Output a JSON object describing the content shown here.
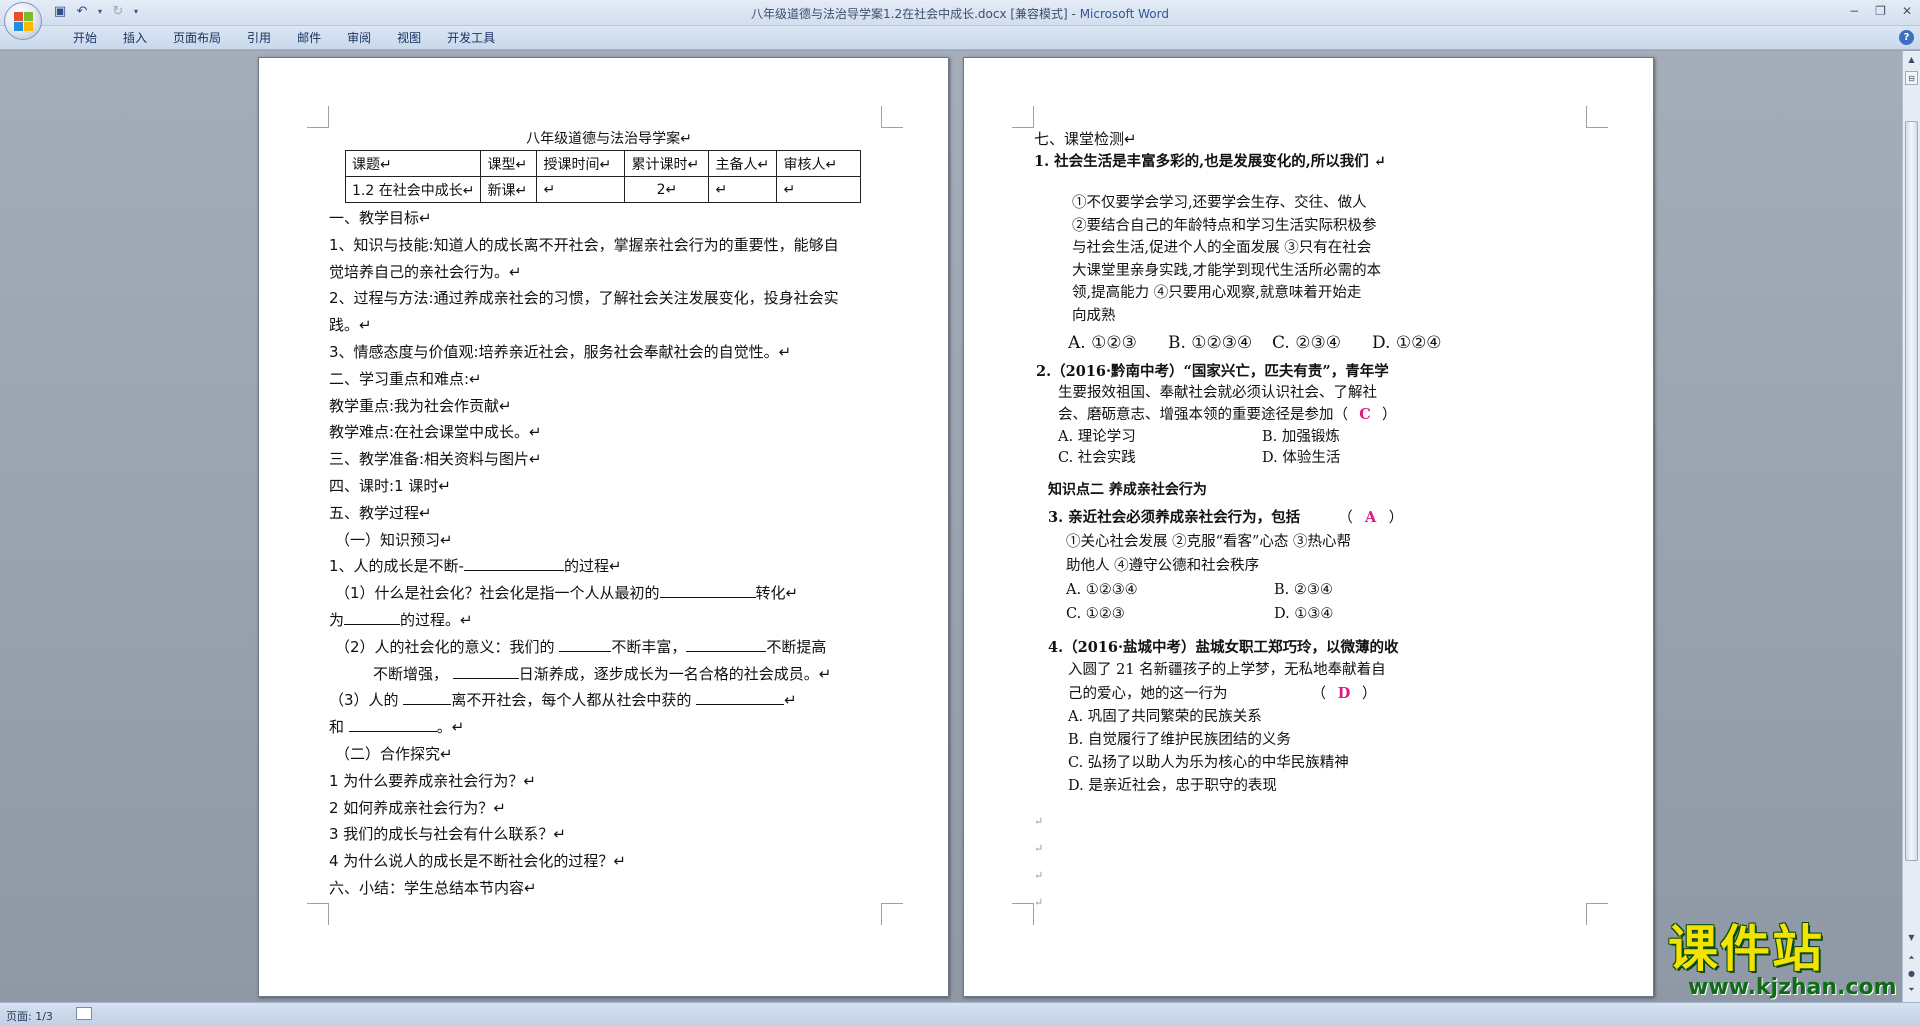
{
  "window": {
    "title_doc": "八年级道德与法治导学案1.2在社会中成长.docx [兼容模式] - ",
    "title_app": "Microsoft Word",
    "min": "−",
    "restore": "❐",
    "close": "✕"
  },
  "ribbon": {
    "tabs": [
      "开始",
      "插入",
      "页面布局",
      "引用",
      "邮件",
      "审阅",
      "视图",
      "开发工具"
    ],
    "help": "?"
  },
  "page1": {
    "title": "八年级道德与法治导学案↵",
    "table": {
      "header": [
        "课题↵",
        "课型↵",
        "授课时间↵",
        "累计课时↵",
        "主备人↵",
        "审核人↵"
      ],
      "row": [
        "1.2 在社会中成长↵",
        "新课↵",
        "↵",
        "2↵",
        "↵",
        "↵"
      ]
    },
    "lines": [
      "一、教学目标↵",
      "1、知识与技能:知道人的成长离不开社会，掌握亲社会行为的重要性，能够自",
      "觉培养自己的亲社会行为。↵",
      "2、过程与方法:通过养成亲社会的习惯，了解社会关注发展变化，投身社会实",
      "践。↵",
      "3、情感态度与价值观:培养亲近社会，服务社会奉献社会的自觉性。↵",
      "二、学习重点和难点:↵",
      "教学重点:我为社会作贡献↵",
      "教学难点:在社会课堂中成长。↵",
      "三、教学准备:相关资料与图片↵",
      "四、课时:1 课时↵",
      "五、教学过程↵",
      "（一）知识预习↵"
    ],
    "fill1": {
      "a": "1、人的成长是不断-",
      "b": "的过程↵"
    },
    "fill2": {
      "a": "（1）什么是社会化？社会化是指一个人从最初的",
      "b": "转化↵"
    },
    "fill3": {
      "a": "为",
      "b": "的过程。↵"
    },
    "fill4": {
      "a": "（2）人的社会化的意义：我们的 ",
      "b": "不断丰富，",
      "c": "不断提高"
    },
    "fill5": {
      "a": "不断增强，  ",
      "b": "日渐养成，逐步成长为一名合格的社会成员。↵"
    },
    "fill6": {
      "a": "（3）人的 ",
      "b": "离不开社会，每个人都从社会中获的 ",
      "c": "↵"
    },
    "fill7": {
      "a": "和 ",
      "b": "。↵"
    },
    "lines2": [
      "（二）合作探究↵",
      "1 为什么要养成亲社会行为？↵",
      "2 如何养成亲社会行为？↵",
      "3 我们的成长与社会有什么联系？↵",
      "4 为什么说人的成长是不断社会化的过程？↵",
      "六、小结：学生总结本节内容↵"
    ]
  },
  "page2": {
    "heading": "七、课堂检测↵",
    "q1": "1. 社会生活是丰富多彩的,也是发展变化的,所以我们  ↵",
    "q1_opts": [
      "①不仅要学会学习,还要学会生存、交往、做人",
      "②要结合自己的年龄特点和学习生活实际积极参",
      "与社会生活,促进个人的全面发展   ③只有在社会",
      "大课堂里亲身实践,才能学到现代生活所必需的本",
      "领,提高能力   ④只要用心观察,就意味着开始走",
      "向成熟"
    ],
    "q1_choices": [
      "A. ①②③",
      "B. ①②③④",
      "C. ②③④",
      "D. ①②④"
    ],
    "q2_lines": [
      "2.（2016·黔南中考）“国家兴亡，匹夫有责”，青年学",
      "生要报效祖国、奉献社会就必须认识社会、了解社",
      "会、磨砺意志、增强本领的重要途径是参加（"
    ],
    "q2_answer": "C",
    "q2_close": "）",
    "q2_opts": [
      "A. 理论学习",
      "B. 加强锻炼",
      "C. 社会实践",
      "D. 体验生活"
    ],
    "kp2": "知识点二   养成亲社会行为",
    "q3_line": "3. 亲近社会必须养成亲社会行为，包括",
    "q3_answer": "A",
    "q3_open": "（",
    "q3_close": "）",
    "q3_lines": [
      "①关心社会发展   ②克服“看客”心态   ③热心帮",
      "助他人   ④遵守公德和社会秩序"
    ],
    "q3_opts": [
      "A. ①②③④",
      "B. ②③④",
      "C. ①②③",
      "D. ①③④"
    ],
    "q4_lines": [
      "4.（2016·盐城中考）盐城女职工郑巧玲，以微薄的收",
      "入圆了 21 名新疆孩子的上学梦，无私地奉献着自",
      "己的爱心，她的这一行为"
    ],
    "q4_answer": "D",
    "q4_open": "（",
    "q4_close": "）",
    "q4_opts": [
      "A. 巩固了共同繁荣的民族关系",
      "B. 自觉履行了维护民族团结的义务",
      "C. 弘扬了以助人为乐为核心的中华民族精神",
      "D. 是亲近社会，忠于职守的表现"
    ],
    "para_marks": [
      "↵",
      "↵",
      "↵",
      "↵"
    ]
  },
  "status": {
    "page": "页面: 1/3"
  },
  "watermark": {
    "text": "课件站",
    "url": "www.kjzhan.com"
  }
}
